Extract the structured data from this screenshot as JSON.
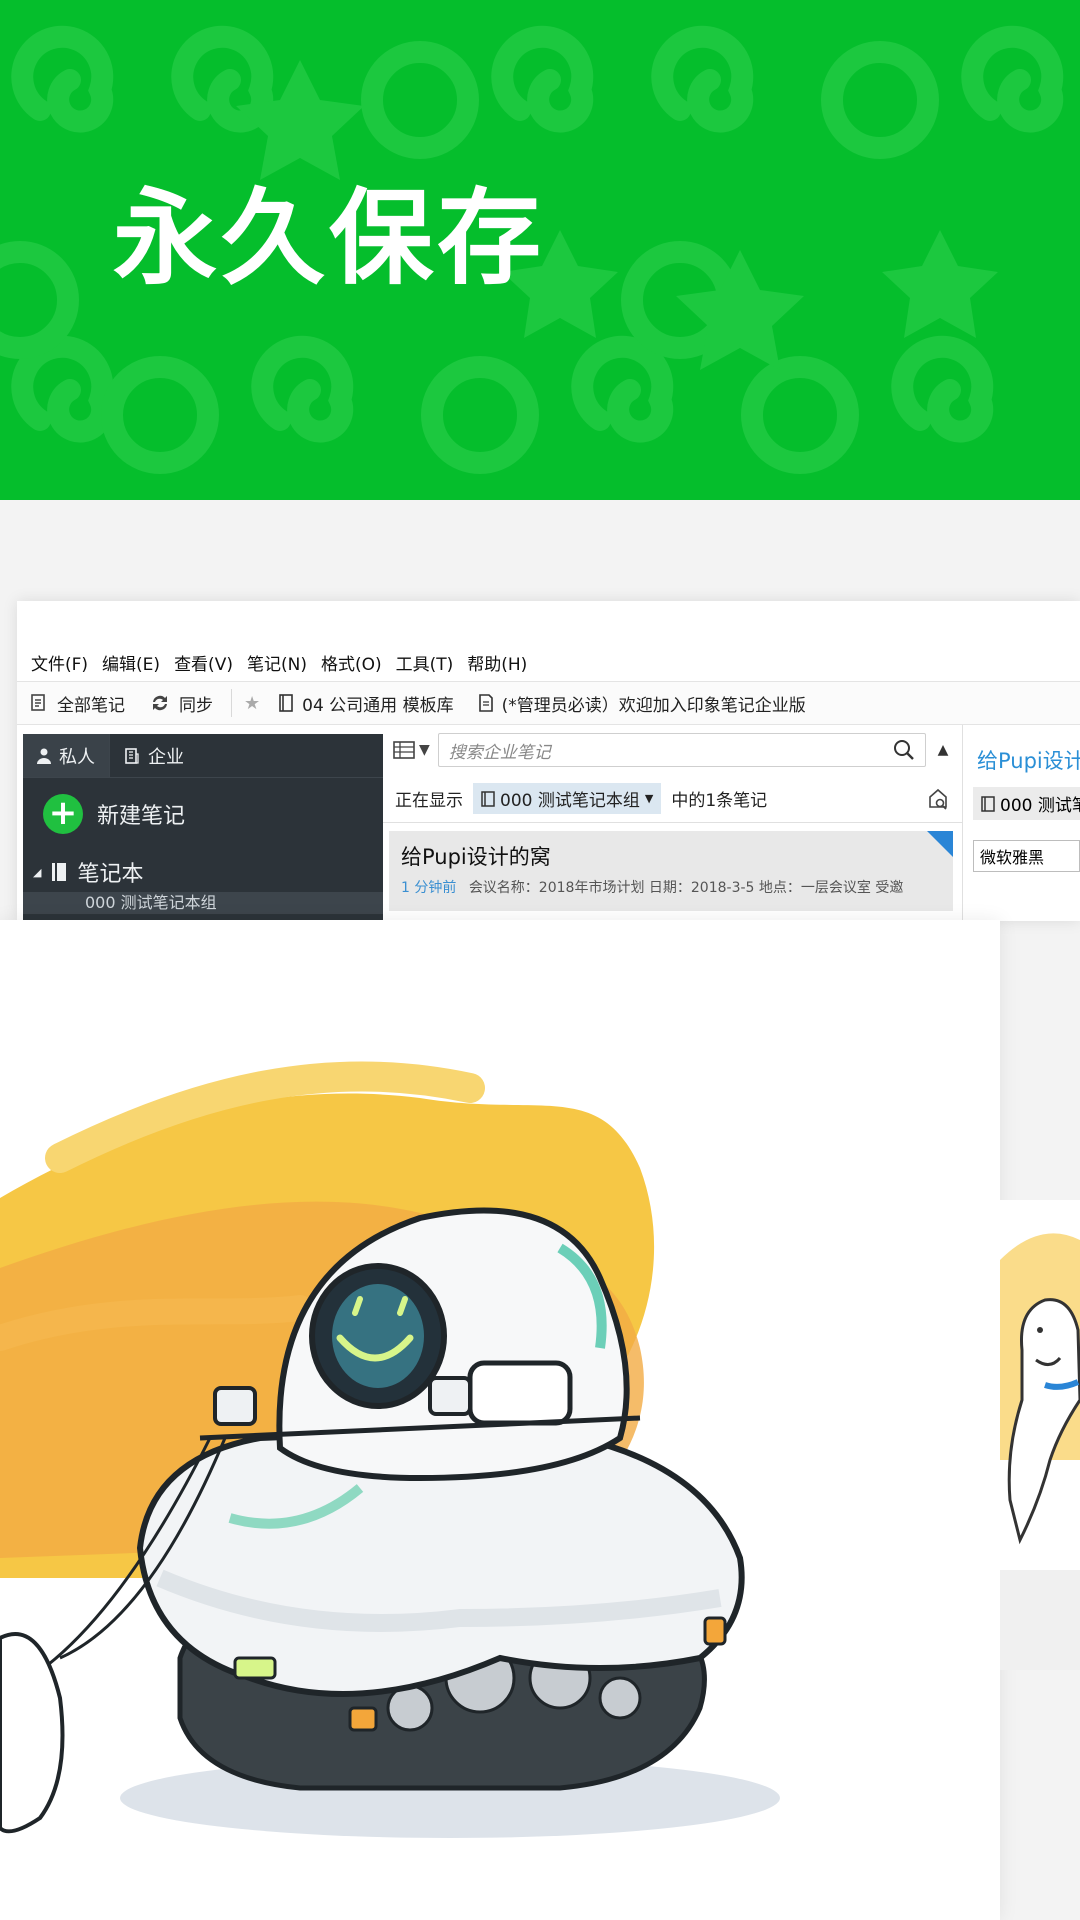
{
  "banner": {
    "title": "永久保存",
    "colors": {
      "background": "#05be2c",
      "pattern": "#1cc83f"
    }
  },
  "app": {
    "menu": [
      "文件(F)",
      "编辑(E)",
      "查看(V)",
      "笔记(N)",
      "格式(O)",
      "工具(T)",
      "帮助(H)"
    ],
    "toolbar": {
      "all_notes": "全部笔记",
      "sync": "同步",
      "shortcut_1": "04 公司通用 模板库",
      "shortcut_2": "(*管理员必读）欢迎加入印象笔记企业版"
    },
    "sidebar": {
      "tab_personal": "私人",
      "tab_business": "企业",
      "new_note": "新建笔记",
      "notebooks": "笔记本",
      "notebook_item": "000 测试笔记本组"
    },
    "note_list": {
      "search_placeholder": "搜索企业笔记",
      "showing_prefix": "正在显示",
      "notebook": "000 测试笔记本组",
      "showing_suffix": "中的1条笔记",
      "note": {
        "title": "给Pupi设计的窝",
        "time": "1 分钟前",
        "snippet": "会议名称：2018年市场计划 日期：2018-3-5 地点：一层会议室 受邀"
      }
    },
    "editor": {
      "title": "给Pupi设计",
      "notebook": "000 测试笔",
      "font": "微软雅黑"
    },
    "colors": {
      "sidebar": "#2c3339",
      "accent_green": "#20c040",
      "link_blue": "#2a8fd6"
    }
  },
  "illustration": {
    "subject": "robot-sketch",
    "colors": {
      "splash_yellow": "#f6c53c",
      "splash_orange": "#f3a63a",
      "robot_body": "#f2f4f6"
    }
  }
}
